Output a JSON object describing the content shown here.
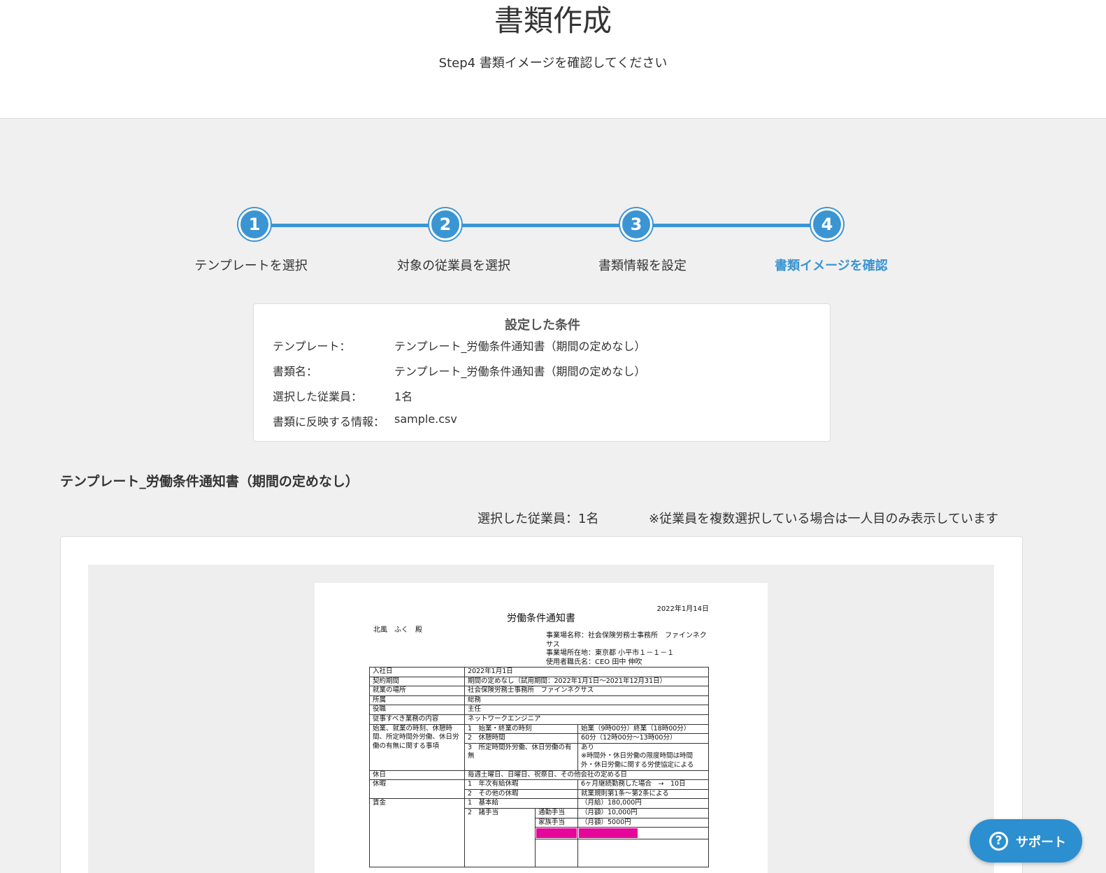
{
  "header": {
    "title": "書類作成",
    "subtitle": "Step4 書類イメージを確認してください"
  },
  "stepper": {
    "steps": [
      {
        "number": "1",
        "label": "テンプレートを選択"
      },
      {
        "number": "2",
        "label": "対象の従業員を選択"
      },
      {
        "number": "3",
        "label": "書類情報を設定"
      },
      {
        "number": "4",
        "label": "書類イメージを確認"
      }
    ],
    "active_step": 4,
    "accent_color": "#3b95d3"
  },
  "conditions": {
    "title": "設定した条件",
    "rows": [
      {
        "key": "テンプレート：",
        "value": "テンプレート_労働条件通知書（期間の定めなし）"
      },
      {
        "key": "書類名：",
        "value": "テンプレート_労働条件通知書（期間の定めなし）"
      },
      {
        "key": "選択した従業員：",
        "value": "1名"
      },
      {
        "key": "書類に反映する情報：",
        "value": "sample.csv"
      }
    ]
  },
  "preview": {
    "heading": "テンプレート_労働条件通知書（期間の定めなし）",
    "selected_count": "選択した従業員：1名",
    "note": "※従業員を複数選択している場合は一人目のみ表示しています",
    "document": {
      "date": "2022年1月14日",
      "title": "労働条件通知書",
      "addressee": "北風　ふく　殿",
      "employer": [
        "事業場名称：社会保険労務士事務所　ファインネクサス",
        "事業場所在地：東京都 小平市１－１－１",
        "使用者職氏名：CEO 田中 伸吹"
      ],
      "rows": [
        {
          "h": "入社日",
          "v": "2022年1月1日"
        },
        {
          "h": "契約期間",
          "v": "期間の定めなし（試用期間：2022年1月1日〜2021年12月31日）"
        },
        {
          "h": "就業の場所",
          "v": "社会保険労務士事務所　ファインネクサス"
        },
        {
          "h": "所属",
          "v": "総務"
        },
        {
          "h": "役職",
          "v": "主任"
        },
        {
          "h": "従事すべき業務の内容",
          "v": "ネットワークエンジニア"
        }
      ],
      "work_time": {
        "h": "始業、就業の時刻、休憩時間、所定時間外労働、休日労働の有無に関する事項",
        "items": [
          {
            "k": "1　始業・終業の時刻",
            "v": "始業（9時00分）終業（18時00分）"
          },
          {
            "k": "2　休憩時間",
            "v": "60分（12時00分〜13時00分）"
          },
          {
            "k": "3　所定時間外労働、休日労働の有無",
            "v": "あり\n※時間外・休日労働の限度時間は時間外・休日労働に関する労使協定による"
          }
        ]
      },
      "holiday": {
        "h": "休日",
        "v": "毎週土曜日、日曜日、祝祭日、その他会社の定める日"
      },
      "leave": {
        "h": "休暇",
        "items": [
          {
            "k": "1　年次有給休暇",
            "v": "6ヶ月継続勤務した場合　→　10日"
          },
          {
            "k": "2　その他の休暇",
            "v": "就業規則第1条〜第2条による"
          }
        ]
      },
      "wage": {
        "h": "賃金",
        "base": {
          "k": "1　基本給",
          "v": "（月給）180,000円"
        },
        "allowance_label": "2　諸手当",
        "allowances": [
          {
            "k": "通勤手当",
            "v": "（月額）10,000円"
          },
          {
            "k": "家族手当",
            "v": "（月額）5000円"
          }
        ],
        "highlight_color": "#e5079a"
      }
    }
  },
  "support": {
    "label": "サポート",
    "icon": "question-icon"
  }
}
